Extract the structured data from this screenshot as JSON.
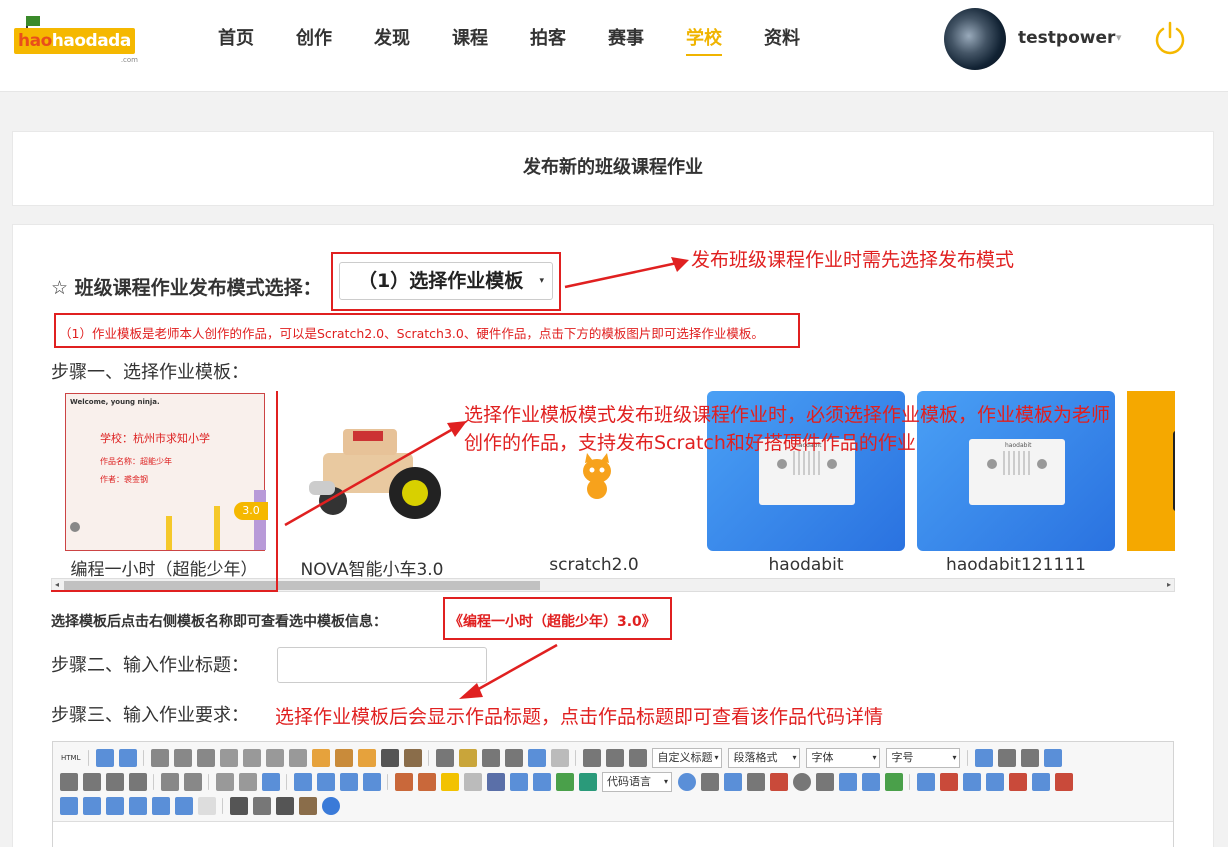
{
  "header": {
    "logo": {
      "text_a": "hao",
      "text_b": "haodada",
      "sub": ".com"
    },
    "nav": [
      {
        "label": "首页",
        "active": false
      },
      {
        "label": "创作",
        "active": false
      },
      {
        "label": "发现",
        "active": false
      },
      {
        "label": "课程",
        "active": false
      },
      {
        "label": "拍客",
        "active": false
      },
      {
        "label": "赛事",
        "active": false
      },
      {
        "label": "学校",
        "active": true
      },
      {
        "label": "资料",
        "active": false
      }
    ],
    "username": "testpower",
    "caret": "▾",
    "accent": "#f0b400"
  },
  "page_title": "发布新的班级课程作业",
  "mode": {
    "label": "☆ 班级课程作业发布模式选择：",
    "selected": "（1）选择作业模板",
    "arrow": "▾",
    "note": "（1）作业模板是老师本人创作的作品，可以是Scratch2.0、Scratch3.0、硬件作品，点击下方的模板图片即可选择作业模板。"
  },
  "annotations": {
    "a1": "发布班级课程作业时需先选择发布模式",
    "a2_line1": "选择作业模板模式发布班级课程作业时，必须选择作业模板，作业模板为老师",
    "a2_line2": "创作的作品，支持发布Scratch和好搭硬件作品的作业",
    "a3": "选择作业模板后会显示作品标题，点击作品标题即可查看该作品代码详情",
    "color": "#e02020"
  },
  "steps": {
    "step1": "步骤一、选择作业模板：",
    "step2": "步骤二、输入作业标题：",
    "step3": "步骤三、输入作业要求："
  },
  "templates": [
    {
      "label": "编程一小时（超能少年）",
      "selected": true,
      "thumb_heading": "Welcome, young ninja.",
      "thumb_school": "学校：杭州市求知小学",
      "thumb_work": "作品名称：超能少年",
      "thumb_author": "作者：裘金钢",
      "version": "3.0"
    },
    {
      "label": "NOVA智能小车3.0",
      "selected": false
    },
    {
      "label": "scratch2.0",
      "selected": false
    },
    {
      "label": "haodabit",
      "selected": false,
      "board_text": "haodabit"
    },
    {
      "label": "haodabit121111",
      "selected": false,
      "board_text": "haodabit"
    }
  ],
  "scroll": {
    "left": "◂",
    "right": "▸"
  },
  "selected_template": {
    "label": "选择模板后点击右侧模板名称即可查看选中模板信息：",
    "name": "《编程一小时（超能少年）3.0》"
  },
  "title_input": {
    "value": "",
    "placeholder": ""
  },
  "editor": {
    "html_label": "HTML",
    "custom_title": "自定义标题",
    "paragraph": "段落格式",
    "font": "字体",
    "size": "字号",
    "code_lang": "代码语言"
  }
}
